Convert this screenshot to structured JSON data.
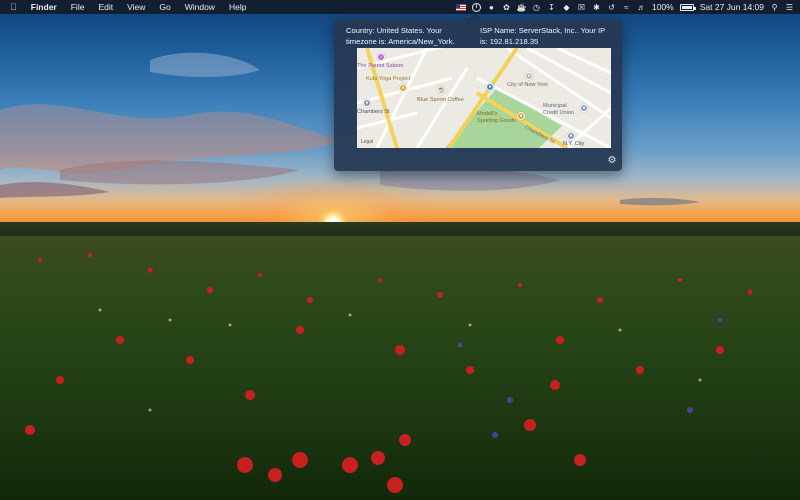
{
  "menubar": {
    "app_name": "Finder",
    "menus": [
      "File",
      "Edit",
      "View",
      "Go",
      "Window",
      "Help"
    ],
    "icons": [
      "flag-icon",
      "info-icon",
      "ghost-icon",
      "fan-icon",
      "cup-icon",
      "download-icon",
      "wifi-icon"
    ],
    "battery": "100%",
    "date_time": "Sat 27 Jun  14:09"
  },
  "popover": {
    "country_text": "Country: United States. Your timezone is: America/New_York.",
    "isp_text": "ISP Name: ServerStack, Inc.. Your IP is: 192.81.218.35",
    "settings_icon": "gear-icon",
    "map": {
      "labels": {
        "patriot_saloon": "The Patriot Saloon",
        "kula_yoga": "Kula Yoga Project",
        "blue_spoon": "Blue Spoon Coffee",
        "city_of_new_york": "City of New York",
        "municipal_credit_union": "Municipal Credit Union",
        "chambers_st_left": "Chambers St",
        "chambers_st_right": "Chambers St",
        "nyc": "N.Y. City",
        "modells": "Modell's Sporting Goods",
        "legal": "Legal"
      }
    }
  }
}
